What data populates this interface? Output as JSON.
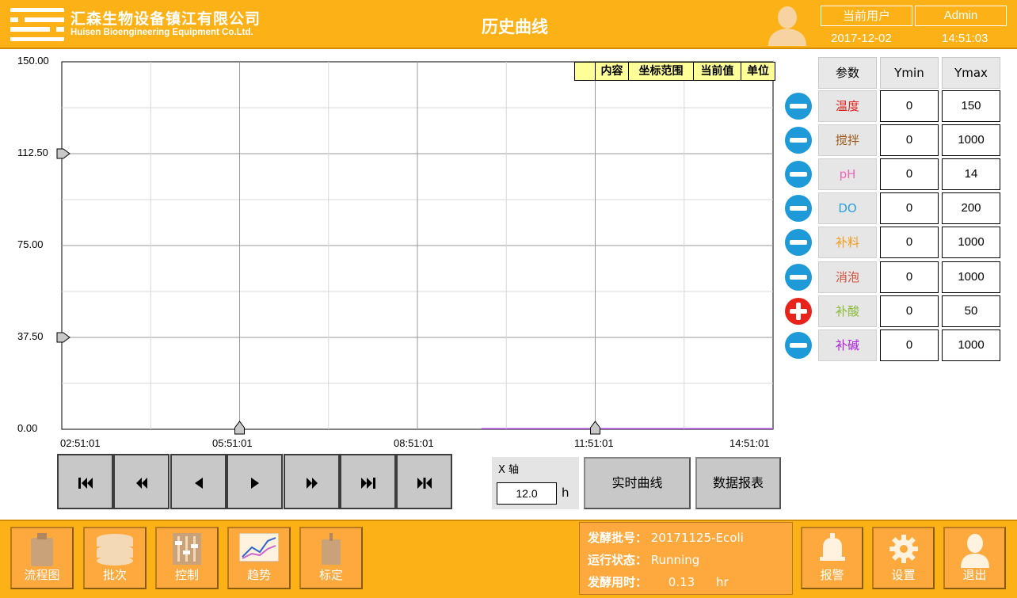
{
  "header": {
    "company_cn": "汇森生物设备镇江有限公司",
    "company_en": "Huisen Bioengineering Equipment Co.Ltd.",
    "title": "历史曲线",
    "user_label": "当前用户",
    "user_name": "Admin",
    "date": "2017-12-02",
    "time": "14:51:03"
  },
  "chart": {
    "y_ticks": [
      "150.00",
      "112.50",
      "75.00",
      "37.50",
      "0.00"
    ],
    "x_ticks": [
      "02:51:01",
      "05:51:01",
      "08:51:01",
      "11:51:01",
      "14:51:01"
    ],
    "legend_headers": [
      "",
      "内容",
      "坐标范围",
      "当前值",
      "单位"
    ]
  },
  "chart_data": {
    "type": "line",
    "title": "历史曲线",
    "x": [
      "02:51:01",
      "05:51:01",
      "08:51:01",
      "11:51:01",
      "14:51:01"
    ],
    "xlim": [
      "02:51:01",
      "14:51:01"
    ],
    "ylim": [
      0,
      150
    ],
    "y_ticks": [
      0,
      37.5,
      75,
      112.5,
      150
    ],
    "grid": true,
    "series": []
  },
  "params": {
    "headers": [
      "参数",
      "Ymin",
      "Ymax"
    ],
    "items": [
      {
        "name": "温度",
        "ymin": "0",
        "ymax": "150",
        "color": "#e0201a",
        "state": "minus"
      },
      {
        "name": "搅拌",
        "ymin": "0",
        "ymax": "1000",
        "color": "#9b5a1c",
        "state": "minus"
      },
      {
        "name": "pH",
        "ymin": "0",
        "ymax": "14",
        "color": "#ee66bb",
        "state": "minus"
      },
      {
        "name": "DO",
        "ymin": "0",
        "ymax": "200",
        "color": "#2a9ee0",
        "state": "minus"
      },
      {
        "name": "补料",
        "ymin": "0",
        "ymax": "1000",
        "color": "#f39a1a",
        "state": "minus"
      },
      {
        "name": "消泡",
        "ymin": "0",
        "ymax": "1000",
        "color": "#d0503a",
        "state": "minus"
      },
      {
        "name": "补酸",
        "ymin": "0",
        "ymax": "50",
        "color": "#88bb33",
        "state": "plus"
      },
      {
        "name": "补碱",
        "ymin": "0",
        "ymax": "1000",
        "color": "#aa22dd",
        "state": "minus"
      }
    ]
  },
  "nav_buttons": [
    "first-icon",
    "rewind-icon",
    "step-back-icon",
    "step-forward-icon",
    "fast-forward-icon",
    "last-icon",
    "jump-end-icon"
  ],
  "xaxis": {
    "label": "X 轴",
    "value": "12.0",
    "unit": "h"
  },
  "actions": {
    "realtime": "实时曲线",
    "report": "数据报表"
  },
  "footer": {
    "buttons": [
      {
        "label": "流程图",
        "icon": "tank-icon"
      },
      {
        "label": "批次",
        "icon": "database-icon"
      },
      {
        "label": "控制",
        "icon": "sliders-icon"
      },
      {
        "label": "趋势",
        "icon": "trend-icon"
      },
      {
        "label": "标定",
        "icon": "calibrate-icon"
      }
    ],
    "batch": {
      "batch_label": "发酵批号：",
      "batch_value": "20171125-Ecoli",
      "status_label": "运行状态：",
      "status_value": "Running",
      "elapsed_label": "发酵用时：",
      "elapsed_value": "0.13",
      "elapsed_unit": "hr"
    },
    "right_buttons": [
      {
        "label": "报警",
        "icon": "bell-icon"
      },
      {
        "label": "设置",
        "icon": "gear-icon"
      },
      {
        "label": "退出",
        "icon": "user-exit-icon"
      }
    ]
  },
  "colors": {
    "header_bg": "#fcb116",
    "footer_button": "#fda93e",
    "minus_toggle": "#1e9ad8",
    "plus_toggle": "#e8231c",
    "legend_bg": "#ffff99",
    "trace": "#cc66ff"
  }
}
